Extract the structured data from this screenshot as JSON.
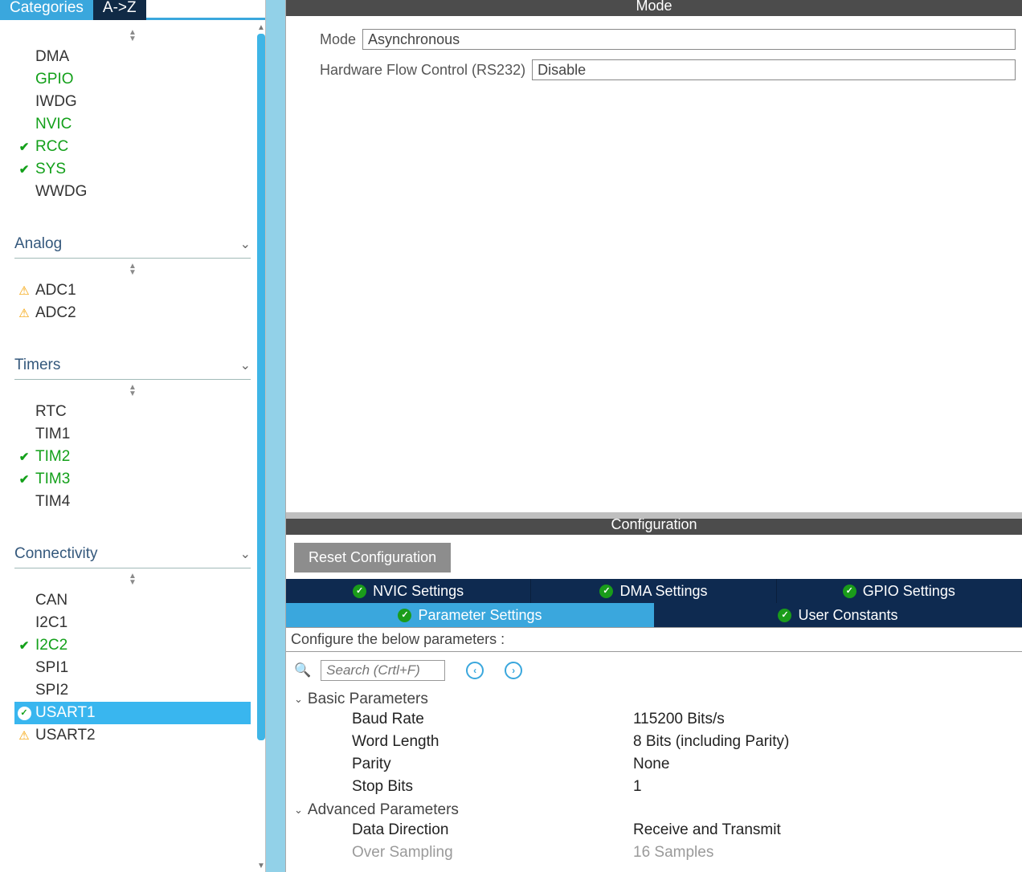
{
  "sidebar": {
    "tabs": {
      "categories": "Categories",
      "az": "A->Z"
    },
    "groups": [
      {
        "id": "system_core",
        "title": "",
        "show_header": false,
        "items": [
          {
            "label": "DMA",
            "status": "",
            "cls": ""
          },
          {
            "label": "GPIO",
            "status": "",
            "cls": "green"
          },
          {
            "label": "IWDG",
            "status": "",
            "cls": ""
          },
          {
            "label": "NVIC",
            "status": "",
            "cls": "green"
          },
          {
            "label": "RCC",
            "status": "check",
            "cls": "green"
          },
          {
            "label": "SYS",
            "status": "check",
            "cls": "green"
          },
          {
            "label": "WWDG",
            "status": "",
            "cls": ""
          }
        ]
      },
      {
        "id": "analog",
        "title": "Analog",
        "show_header": true,
        "items": [
          {
            "label": "ADC1",
            "status": "warn",
            "cls": ""
          },
          {
            "label": "ADC2",
            "status": "warn",
            "cls": ""
          }
        ]
      },
      {
        "id": "timers",
        "title": "Timers",
        "show_header": true,
        "items": [
          {
            "label": "RTC",
            "status": "",
            "cls": ""
          },
          {
            "label": "TIM1",
            "status": "",
            "cls": ""
          },
          {
            "label": "TIM2",
            "status": "check",
            "cls": "green"
          },
          {
            "label": "TIM3",
            "status": "check",
            "cls": "green"
          },
          {
            "label": "TIM4",
            "status": "",
            "cls": ""
          }
        ]
      },
      {
        "id": "connectivity",
        "title": "Connectivity",
        "show_header": true,
        "items": [
          {
            "label": "CAN",
            "status": "",
            "cls": ""
          },
          {
            "label": "I2C1",
            "status": "",
            "cls": ""
          },
          {
            "label": "I2C2",
            "status": "check",
            "cls": "green"
          },
          {
            "label": "SPI1",
            "status": "",
            "cls": ""
          },
          {
            "label": "SPI2",
            "status": "",
            "cls": ""
          },
          {
            "label": "USART1",
            "status": "okcircle",
            "cls": "selected"
          },
          {
            "label": "USART2",
            "status": "warn",
            "cls": ""
          }
        ]
      }
    ]
  },
  "mode_panel": {
    "title": "Mode",
    "rows": [
      {
        "label": "Mode",
        "value": "Asynchronous"
      },
      {
        "label": "Hardware Flow Control (RS232)",
        "value": "Disable"
      }
    ]
  },
  "config_panel": {
    "title": "Configuration",
    "reset_label": "Reset Configuration",
    "tabs_row1": [
      {
        "label": "NVIC Settings"
      },
      {
        "label": "DMA Settings"
      },
      {
        "label": "GPIO Settings"
      }
    ],
    "tabs_row2": [
      {
        "label": "Parameter Settings",
        "active": true
      },
      {
        "label": "User Constants",
        "active": false
      }
    ],
    "instruction": "Configure the below parameters :",
    "search_placeholder": "Search (Crtl+F)",
    "groups": [
      {
        "title": "Basic Parameters",
        "rows": [
          {
            "key": "Baud Rate",
            "value": "115200 Bits/s",
            "dim": false
          },
          {
            "key": "Word Length",
            "value": "8 Bits (including Parity)",
            "dim": false
          },
          {
            "key": "Parity",
            "value": "None",
            "dim": false
          },
          {
            "key": "Stop Bits",
            "value": "1",
            "dim": false
          }
        ]
      },
      {
        "title": "Advanced Parameters",
        "rows": [
          {
            "key": "Data Direction",
            "value": "Receive and Transmit",
            "dim": false
          },
          {
            "key": "Over Sampling",
            "value": "16 Samples",
            "dim": true
          }
        ]
      }
    ]
  }
}
